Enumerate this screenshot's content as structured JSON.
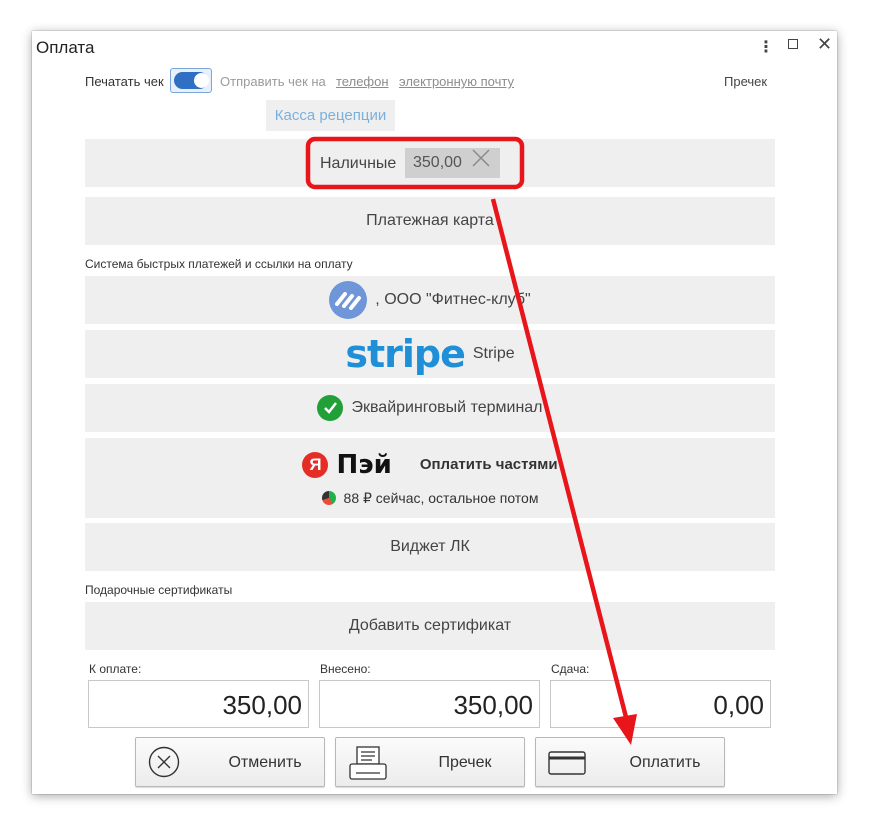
{
  "window": {
    "title": "Оплата",
    "controls": {
      "more": "⋮",
      "close": "✕"
    }
  },
  "receipt": {
    "print_label": "Печатать чек",
    "print_enabled": true,
    "send_label": "Отправить чек на",
    "phone_link": "телефон",
    "email_link": "электронную почту",
    "reprint_link": "Пречек"
  },
  "cashbox": {
    "label": "Касса рецепции"
  },
  "payments": {
    "cash": {
      "label": "Наличные",
      "amount": "350,00",
      "clear_icon": "close-icon"
    },
    "card": {
      "label": "Платежная карта"
    }
  },
  "fast_payments": {
    "section_label": "Система быстрых платежей и ссылки на оплату",
    "sbp": {
      "label": ", ООО \"Фитнес-клуб\"",
      "icon": "sbp-icon"
    },
    "stripe": {
      "logo": "stripe",
      "label": "Stripe"
    },
    "acquiring": {
      "label": "Эквайринговый терминал",
      "icon": "sber-icon"
    },
    "yandex_pay": {
      "logo_letter": "Я",
      "logo_text": "Пэй",
      "label": "Оплатить частями",
      "sub_label": "88 ₽ сейчас, остальное потом"
    },
    "widget": {
      "label": "Виджет ЛК"
    }
  },
  "certificates": {
    "section_label": "Подарочные сертификаты",
    "add_label": "Добавить сертификат"
  },
  "totals": {
    "to_pay_label": "К оплате:",
    "to_pay": "350,00",
    "paid_label": "Внесено:",
    "paid": "350,00",
    "change_label": "Сдача:",
    "change": "0,00"
  },
  "buttons": {
    "cancel": "Отменить",
    "precheck": "Пречек",
    "pay": "Оплатить"
  },
  "colors": {
    "accent": "#2f6fc4",
    "highlight": "#e8151b",
    "row_bg": "#efefef"
  }
}
